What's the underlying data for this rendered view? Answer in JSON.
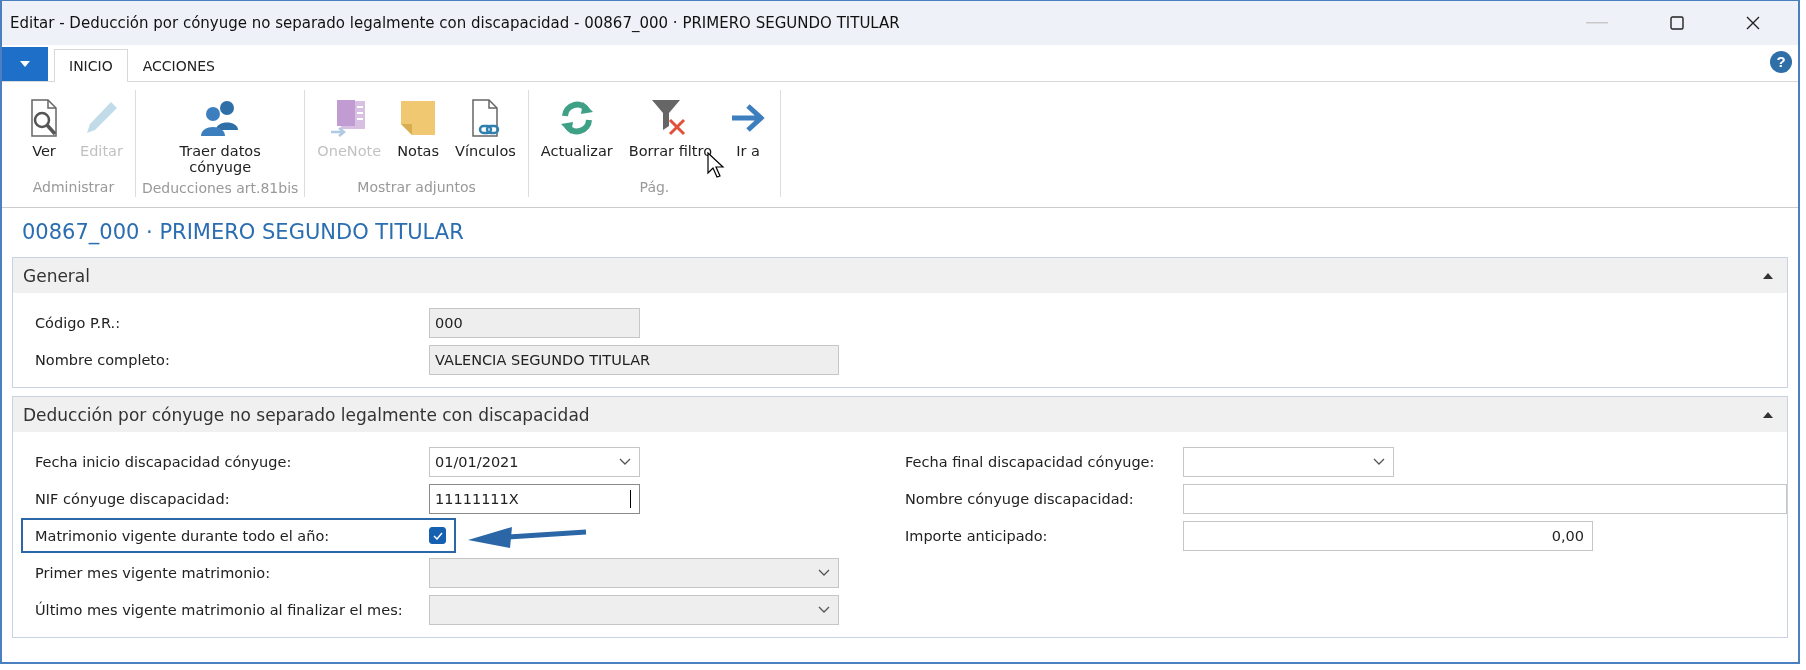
{
  "window": {
    "title": "Editar - Deducción por cónyuge no separado legalmente con discapacidad - 00867_000 · PRIMERO SEGUNDO TITULAR"
  },
  "tabs": [
    {
      "label": "INICIO",
      "selected": true
    },
    {
      "label": "ACCIONES",
      "selected": false
    }
  ],
  "help_button": "?",
  "ribbon_groups": [
    {
      "label": "Administrar",
      "items": [
        {
          "label": "Ver",
          "disabled": false
        },
        {
          "label": "Editar",
          "disabled": true
        }
      ]
    },
    {
      "label": "Deducciones art.81bis",
      "items": [
        {
          "label": "Traer datos cónyuge",
          "disabled": false
        }
      ]
    },
    {
      "label": "Mostrar adjuntos",
      "items": [
        {
          "label": "OneNote",
          "disabled": true
        },
        {
          "label": "Notas",
          "disabled": false
        },
        {
          "label": "Vínculos",
          "disabled": false
        }
      ]
    },
    {
      "label": "Pág.",
      "items": [
        {
          "label": "Actualizar",
          "disabled": false
        },
        {
          "label": "Borrar filtro",
          "disabled": false
        },
        {
          "label": "Ir a",
          "disabled": false
        }
      ]
    }
  ],
  "page_title": "00867_000 · PRIMERO SEGUNDO TITULAR",
  "sections": [
    {
      "title": "General",
      "expanded": true,
      "columns": [
        [
          {
            "kind": "text",
            "label": "Código P.R.:",
            "value": "000",
            "editable": false
          },
          {
            "kind": "text",
            "label": "Nombre completo:",
            "value": "VALENCIA SEGUNDO TITULAR",
            "editable": false
          }
        ]
      ]
    },
    {
      "title": "Deducción por cónyuge no separado legalmente con discapacidad",
      "expanded": true,
      "columns": [
        [
          {
            "kind": "dropdown",
            "label": "Fecha inicio discapacidad cónyuge:",
            "value": "01/01/2021",
            "editable": true
          },
          {
            "kind": "text",
            "label": "NIF cónyuge discapacidad:",
            "value": "11111111X",
            "editable": true,
            "focused": true
          },
          {
            "kind": "checkbox",
            "label": "Matrimonio vigente durante todo el año:",
            "checked": true,
            "highlighted": true
          },
          {
            "kind": "dropdown",
            "label": "Primer mes vigente matrimonio:",
            "editable": false
          },
          {
            "kind": "dropdown",
            "label": "Último mes vigente matrimonio al finalizar el mes:",
            "editable": false
          }
        ],
        [
          {
            "kind": "dropdown",
            "label": "Fecha final discapacidad cónyuge:",
            "editable": true
          },
          {
            "kind": "text",
            "label": "Nombre cónyuge discapacidad:",
            "editable": true
          },
          {
            "kind": "number",
            "label": "Importe anticipado:",
            "value": "0,00",
            "editable": true
          }
        ]
      ]
    }
  ]
}
